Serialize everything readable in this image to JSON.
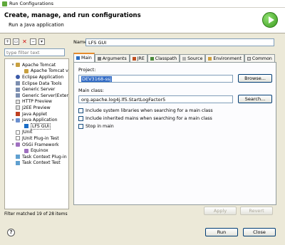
{
  "window": {
    "title": "Run Configurations"
  },
  "header": {
    "title": "Create, manage, and run configurations",
    "subtitle": "Run a Java application"
  },
  "left": {
    "filter_placeholder": "type filter text",
    "tree": [
      {
        "label": "Apache Tomcat",
        "indent": 1,
        "icon": "tomcat",
        "twisty": "▾"
      },
      {
        "label": "Apache Tomcat v",
        "indent": 2,
        "icon": "tomcat"
      },
      {
        "label": "Eclipse Application",
        "indent": 1,
        "icon": "eclipse"
      },
      {
        "label": "Eclipse Data Tools",
        "indent": 1,
        "icon": "server"
      },
      {
        "label": "Generic Server",
        "indent": 1,
        "icon": "server"
      },
      {
        "label": "Generic Server(Extern",
        "indent": 1,
        "icon": "server"
      },
      {
        "label": "HTTP Preview",
        "indent": 1,
        "icon": "html"
      },
      {
        "label": "J2EE Preview",
        "indent": 1,
        "icon": "html"
      },
      {
        "label": "Java Applet",
        "indent": 1,
        "icon": "applet"
      },
      {
        "label": "Java Application",
        "indent": 1,
        "icon": "java",
        "twisty": "▾"
      },
      {
        "label": "LFS GUI",
        "indent": 2,
        "icon": "selected",
        "selected": true
      },
      {
        "label": "JUnit",
        "indent": 1,
        "icon": "junit"
      },
      {
        "label": "JUnit Plug-in Test",
        "indent": 1,
        "icon": "junit"
      },
      {
        "label": "OSGi Framework",
        "indent": 1,
        "icon": "osgi",
        "twisty": "▾"
      },
      {
        "label": "Equinox",
        "indent": 2,
        "icon": "osgi"
      },
      {
        "label": "Task Context Plug-in",
        "indent": 1,
        "icon": "task"
      },
      {
        "label": "Task Context Test",
        "indent": 1,
        "icon": "task"
      }
    ],
    "status": "Filter matched 19 of 28 items"
  },
  "right": {
    "name_label": "Name:",
    "name_value": "LFS GUI",
    "tabs": [
      {
        "label": "Main",
        "icon": "m",
        "active": true
      },
      {
        "label": "Arguments",
        "icon": "a"
      },
      {
        "label": "JRE",
        "icon": "j"
      },
      {
        "label": "Classpath",
        "icon": "c"
      },
      {
        "label": "Source",
        "icon": "s"
      },
      {
        "label": "Environment",
        "icon": "e"
      },
      {
        "label": "Common",
        "icon": "co"
      }
    ],
    "project_label": "Project:",
    "project_value": "DEV3168-ssj",
    "browse_label": "Browse...",
    "main_class_label": "Main class:",
    "main_class_value": "org.apache.log4j.lf5.StartLogFactor5",
    "search_label": "Search...",
    "checkboxes": [
      "Include system libraries when searching for a main class",
      "Include inherited mains when searching for a main class",
      "Stop in main"
    ],
    "apply_label": "Apply",
    "revert_label": "Revert"
  },
  "footer": {
    "help_glyph": "?",
    "run_label": "Run",
    "close_label": "Close"
  }
}
